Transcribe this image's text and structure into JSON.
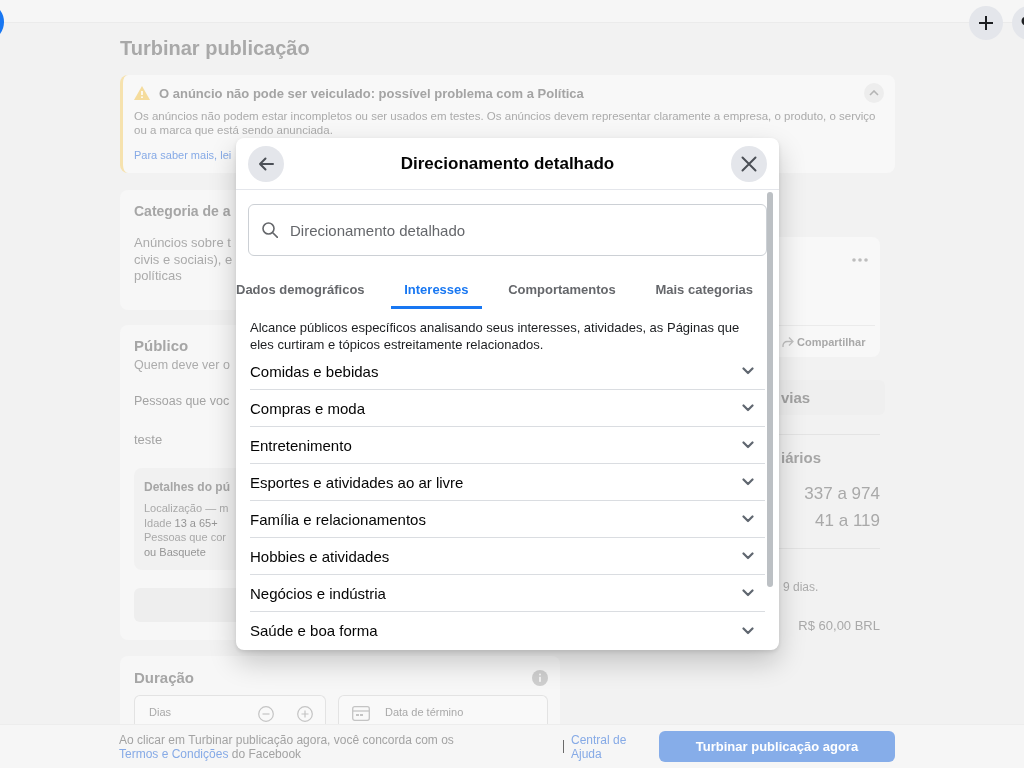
{
  "page_title": "Turbinar publicação",
  "policy_alert": {
    "title": "O anúncio não pode ser veiculado: possível problema com a Política",
    "body": "Os anúncios não podem estar incompletos ou ser usados em testes. Os anúncios devem representar claramente a empresa, o produto, o serviço ou a marca que está sendo anunciada.",
    "link": "Para saber mais, lei"
  },
  "category_card": {
    "title": "Categoria de a",
    "description_lines": [
      "Anúncios sobre t",
      "civis e sociais), e",
      "políticas"
    ]
  },
  "audience_card": {
    "title": "Público",
    "subtitle": "Quem deve ver o",
    "prompt": "Pessoas que voc",
    "audience_name": "teste",
    "details": {
      "title": "Detalhes do pú",
      "lines": [
        {
          "label": "Localização — m"
        },
        {
          "label": "Idade",
          "value": "13 a 65+"
        },
        {
          "label": "Pessoas que cor"
        },
        {
          "value": "ou Basquete"
        }
      ]
    }
  },
  "duration_card": {
    "title": "Duração",
    "days_label": "Dias",
    "end_date_label": "Data de término"
  },
  "summary": {
    "share_label": "Compartilhar",
    "preview_button": "vias",
    "results_title": "iários",
    "results": [
      "337 a 974",
      "41 a 119"
    ],
    "duration_note": "9 dias.",
    "budget": "R$ 60,00 BRL"
  },
  "footer": {
    "consent_before": "Ao clicar em Turbinar publicação agora, você concorda com os",
    "terms_link": "Termos e Condições",
    "consent_after": "do Facebook",
    "help_link": "Central de Ajuda",
    "submit_button": "Turbinar publicação agora"
  },
  "modal": {
    "title": "Direcionamento detalhado",
    "search": {
      "placeholder": "Direcionamento detalhado"
    },
    "tabs": [
      {
        "label": "Dados demográficos",
        "selected": false
      },
      {
        "label": "Interesses",
        "selected": true
      },
      {
        "label": "Comportamentos",
        "selected": false
      },
      {
        "label": "Mais categorias",
        "selected": false
      }
    ],
    "description": "Alcance públicos específicos analisando seus interesses, atividades, as Páginas que eles curtiram e tópicos estreitamente relacionados.",
    "categories": [
      {
        "label": "Comidas e bebidas",
        "expanded": false
      },
      {
        "label": "Compras e moda",
        "expanded": false
      },
      {
        "label": "Entretenimento",
        "expanded": false
      },
      {
        "label": "Esportes e atividades ao ar livre",
        "expanded": false
      },
      {
        "label": "Família e relacionamentos",
        "expanded": false
      },
      {
        "label": "Hobbies e atividades",
        "expanded": false
      },
      {
        "label": "Negócios e indústria",
        "expanded": false
      },
      {
        "label": "Saúde e boa forma",
        "expanded": false
      }
    ]
  }
}
